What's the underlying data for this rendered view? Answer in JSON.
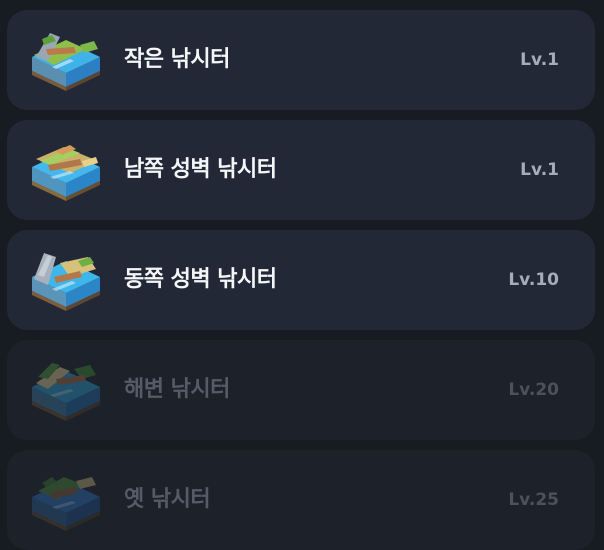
{
  "colors": {
    "background": "#171b22",
    "card": "#222836",
    "card_locked": "#1c212a",
    "title": "#f5f6f8",
    "title_locked": "#565c67",
    "level": "#a7adb8",
    "level_locked": "#4c525c"
  },
  "spots": [
    {
      "name": "작은 낚시터",
      "level": "Lv.1",
      "icon": "small-fishing-spot-icon",
      "locked": false
    },
    {
      "name": "남쪽 성벽 낚시터",
      "level": "Lv.1",
      "icon": "south-wall-fishing-spot-icon",
      "locked": false
    },
    {
      "name": "동쪽 성벽 낚시터",
      "level": "Lv.10",
      "icon": "east-wall-fishing-spot-icon",
      "locked": false
    },
    {
      "name": "해변 낚시터",
      "level": "Lv.20",
      "icon": "beach-fishing-spot-icon",
      "locked": true
    },
    {
      "name": "옛 낚시터",
      "level": "Lv.25",
      "icon": "old-fishing-spot-icon",
      "locked": true
    }
  ]
}
